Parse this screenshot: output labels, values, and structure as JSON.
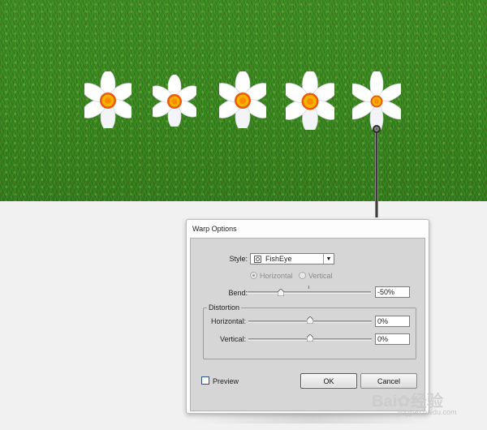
{
  "dialog": {
    "title": "Warp Options",
    "style_label": "Style:",
    "style_value": "FishEye",
    "orientation": {
      "horizontal_label": "Horizontal",
      "vertical_label": "Vertical",
      "selected": "Horizontal"
    },
    "bend_label": "Bend:",
    "bend_value": "-50%",
    "distortion": {
      "group_label": "Distortion",
      "horizontal_label": "Horizontal:",
      "horizontal_value": "0%",
      "vertical_label": "Vertical:",
      "vertical_value": "0%"
    },
    "preview_label": "Preview",
    "ok_label": "OK",
    "cancel_label": "Cancel"
  },
  "sliders": {
    "bend_percent": -50,
    "distortion_horizontal_percent": 0,
    "distortion_vertical_percent": 0
  },
  "scene": {
    "flower_count": 5,
    "grass_color": "#3a8a21",
    "petal_color": "#ffffff",
    "center_color": "#f0a000"
  },
  "watermark": {
    "brand": "Bai",
    "brand_suffix": "经验",
    "url": "jingyan.baidu.com"
  }
}
